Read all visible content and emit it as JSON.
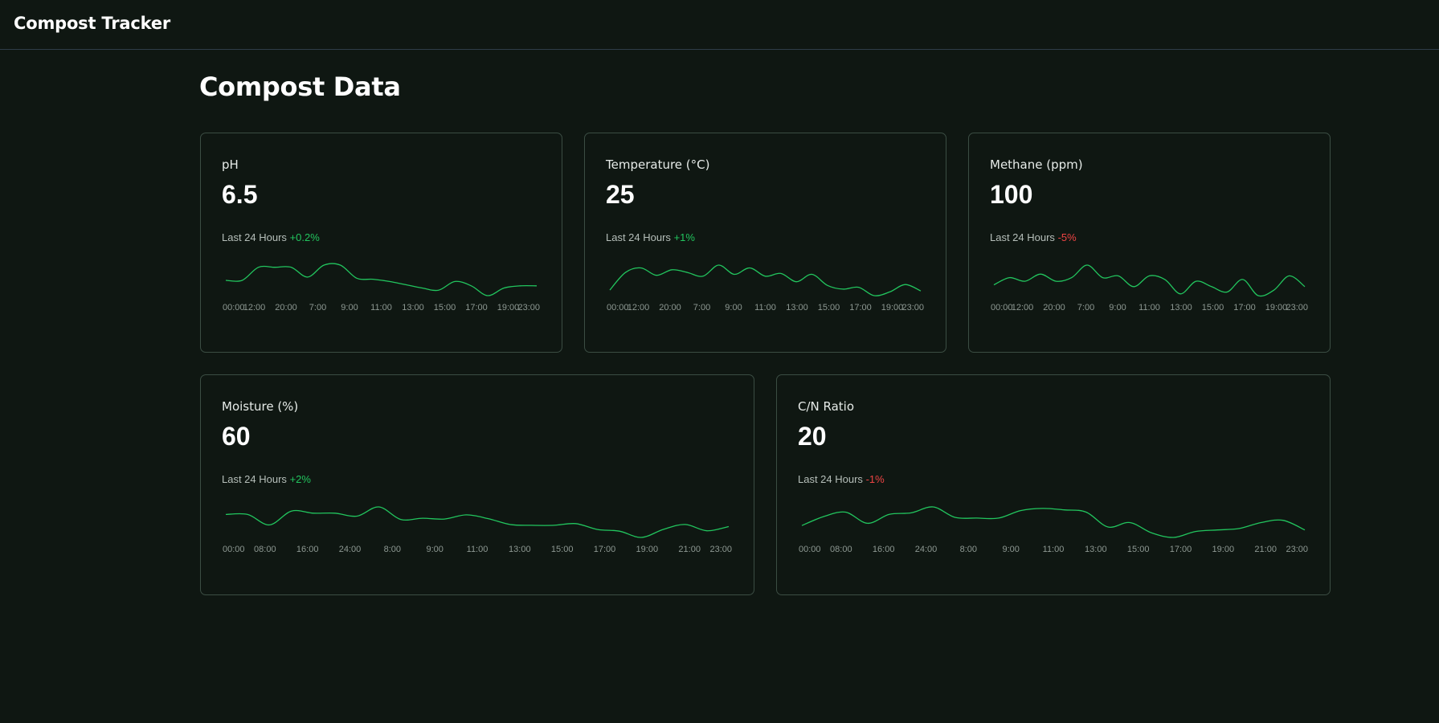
{
  "app": {
    "title": "Compost Tracker"
  },
  "page": {
    "title": "Compost Data"
  },
  "colors": {
    "line": "#22c55e",
    "positive": "#22c55e",
    "negative": "#ef4444",
    "background": "#0f1712",
    "border": "#3b4d43"
  },
  "cards": [
    {
      "title": "pH",
      "value": "6.5",
      "period_label": "Last 24 Hours",
      "change": "+0.2%",
      "trend": "positive",
      "chart_data": {
        "type": "line",
        "x": [
          "00:00",
          "12:00",
          "20:00",
          "7:00",
          "9:00",
          "11:00",
          "13:00",
          "15:00",
          "17:00",
          "19:00",
          "23:00"
        ],
        "values": [
          6.3,
          6.3,
          6.42,
          6.42,
          6.42,
          6.33,
          6.44,
          6.44,
          6.32,
          6.31,
          6.29,
          6.26,
          6.23,
          6.21,
          6.29,
          6.25,
          6.16,
          6.23,
          6.25,
          6.25
        ]
      }
    },
    {
      "title": "Temperature (°C)",
      "value": "25",
      "period_label": "Last 24 Hours",
      "change": "+1%",
      "trend": "positive",
      "chart_data": {
        "type": "line",
        "x": [
          "00:00",
          "12:00",
          "20:00",
          "7:00",
          "9:00",
          "11:00",
          "13:00",
          "15:00",
          "17:00",
          "19:00",
          "23:00"
        ],
        "values": [
          22.4,
          24.3,
          24.8,
          24.0,
          24.6,
          24.3,
          23.9,
          25.1,
          24.1,
          24.8,
          23.9,
          24.2,
          23.3,
          24.1,
          22.9,
          22.5,
          22.7,
          21.8,
          22.2,
          23.0,
          22.3
        ]
      }
    },
    {
      "title": "Methane (ppm)",
      "value": "100",
      "period_label": "Last 24 Hours",
      "change": "-5%",
      "trend": "negative",
      "chart_data": {
        "type": "line",
        "x": [
          "00:00",
          "12:00",
          "20:00",
          "7:00",
          "9:00",
          "11:00",
          "13:00",
          "15:00",
          "17:00",
          "19:00",
          "23:00"
        ],
        "values": [
          93,
          97,
          95,
          99,
          95,
          97,
          104,
          97,
          98,
          92,
          98,
          96,
          88,
          95,
          92,
          89,
          96,
          87,
          90,
          98,
          92
        ]
      }
    },
    {
      "title": "Moisture (%)",
      "value": "60",
      "period_label": "Last 24 Hours",
      "change": "+2%",
      "trend": "positive",
      "chart_data": {
        "type": "line",
        "x": [
          "00:00",
          "08:00",
          "16:00",
          "24:00",
          "8:00",
          "9:00",
          "11:00",
          "13:00",
          "15:00",
          "17:00",
          "19:00",
          "21:00",
          "23:00"
        ],
        "values": [
          58.0,
          58.0,
          55.5,
          58.8,
          58.3,
          58.3,
          57.6,
          59.8,
          56.8,
          57.1,
          56.9,
          57.9,
          57.0,
          55.6,
          55.4,
          55.4,
          55.8,
          54.4,
          54.0,
          52.5,
          54.4,
          55.6,
          54.1,
          55.1
        ]
      }
    },
    {
      "title": "C/N Ratio",
      "value": "20",
      "period_label": "Last 24 Hours",
      "change": "-1%",
      "trend": "negative",
      "chart_data": {
        "type": "line",
        "x": [
          "00:00",
          "08:00",
          "16:00",
          "24:00",
          "8:00",
          "9:00",
          "11:00",
          "13:00",
          "15:00",
          "17:00",
          "19:00",
          "21:00",
          "23:00"
        ],
        "values": [
          18.4,
          19.6,
          20.2,
          18.7,
          19.9,
          20.1,
          20.9,
          19.5,
          19.4,
          19.4,
          20.4,
          20.7,
          20.5,
          20.2,
          18.2,
          18.8,
          17.4,
          16.8,
          17.6,
          17.8,
          18.0,
          18.8,
          19.1,
          17.8
        ]
      }
    }
  ]
}
